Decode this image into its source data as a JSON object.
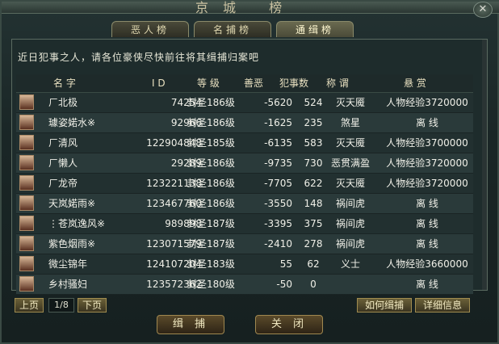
{
  "window": {
    "title": "京城 榜"
  },
  "tabs": [
    {
      "label": "恶人榜",
      "active": false
    },
    {
      "label": "名捕榜",
      "active": false
    },
    {
      "label": "通缉榜",
      "active": true
    }
  ],
  "notice": "近日犯事之人，请各位豪侠尽快前往将其缉捕归案吧",
  "table": {
    "headers": [
      "名 字",
      "I D",
      "等 级",
      "善恶",
      "犯事数",
      "称 谓",
      "悬 赏"
    ],
    "rows": [
      {
        "name": "ㄏ北极",
        "id": "74254",
        "level": "封圣186级",
        "good": "-5620",
        "crimes": "524",
        "title": "灭天魇",
        "reward": "人物经验3720000"
      },
      {
        "name": "璩姿婼水※",
        "id": "92966",
        "level": "封圣186级",
        "good": "-1625",
        "crimes": "235",
        "title": "煞星",
        "reward": "离 线"
      },
      {
        "name": "ㄏ清风",
        "id": "122904848",
        "level": "封圣185级",
        "good": "-6135",
        "crimes": "583",
        "title": "灭天魇",
        "reward": "人物经验3700000"
      },
      {
        "name": "ㄏ懒人",
        "id": "29289",
        "level": "封圣186级",
        "good": "-9735",
        "crimes": "730",
        "title": "恶贯满盈",
        "reward": "人物经验3720000"
      },
      {
        "name": "ㄏ龙帝",
        "id": "123221138",
        "level": "封圣186级",
        "good": "-7705",
        "crimes": "622",
        "title": "灭天魇",
        "reward": "人物经验3720000"
      },
      {
        "name": "天岚婼雨※",
        "id": "123467760",
        "level": "封圣186级",
        "good": "-3550",
        "crimes": "148",
        "title": "祸间虎",
        "reward": "离 线"
      },
      {
        "name": "⋮苍岚逸风※",
        "id": "989898",
        "level": "封圣187级",
        "good": "-3395",
        "crimes": "375",
        "title": "祸间虎",
        "reward": "离 线"
      },
      {
        "name": "紫色烟雨※",
        "id": "123071579",
        "level": "封圣187级",
        "good": "-2410",
        "crimes": "278",
        "title": "祸间虎",
        "reward": "离 线"
      },
      {
        "name": "微尘锦年",
        "id": "124107204",
        "level": "封圣183级",
        "good": "55",
        "crimes": "62",
        "title": "义士",
        "reward": "人物经验3660000"
      },
      {
        "name": "乡村骚妇",
        "id": "123572362",
        "level": "封圣180级",
        "good": "-50",
        "crimes": "0",
        "title": "",
        "reward": "离 线"
      }
    ]
  },
  "pager": {
    "prev": "上页",
    "page": "1/8",
    "next": "下页"
  },
  "actions": {
    "how_to_catch": "如何缉捕",
    "details": "详细信息",
    "catch": "缉捕",
    "close": "关闭"
  },
  "icons": {
    "close": "close-icon"
  }
}
